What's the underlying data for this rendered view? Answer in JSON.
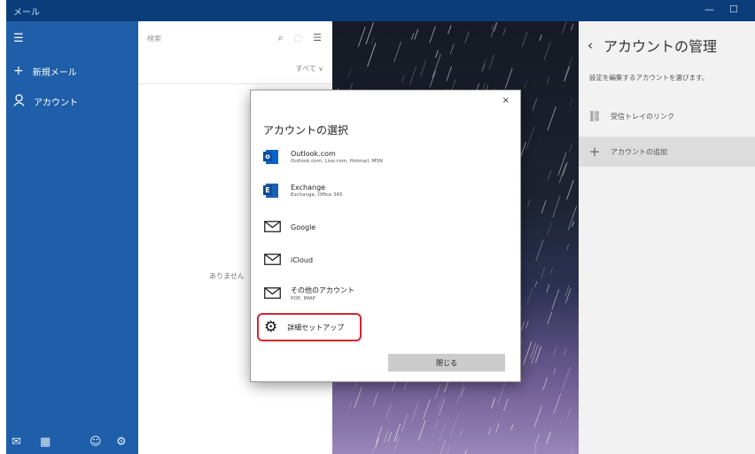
{
  "window": {
    "title": "メール",
    "controls": [
      "—",
      "☐"
    ]
  },
  "nav": {
    "items": [
      {
        "label": "新規メール",
        "icon": "plus-icon"
      },
      {
        "label": "アカウント",
        "icon": "person-icon"
      }
    ],
    "bottom_icons": [
      "mail-icon",
      "calendar-icon",
      "smiley-icon",
      "gear-icon"
    ]
  },
  "list": {
    "search_placeholder": "検索",
    "filter": "すべて ∨",
    "empty_text": "ありません"
  },
  "account_pane": {
    "title": "アカウントの管理",
    "description": "設定を編集するアカウントを選びます。",
    "items": [
      {
        "label": "受信トレイのリンク",
        "icon": "link-icon"
      },
      {
        "label": "アカウントの追加",
        "icon": "plus-icon"
      }
    ]
  },
  "dialog": {
    "title": "アカウントの選択",
    "close": "×",
    "accounts": [
      {
        "name": "Outlook.com",
        "sub": "Outlook.com, Live.com, Hotmail, MSN",
        "icon": "outlook-icon"
      },
      {
        "name": "Exchange",
        "sub": "Exchange, Office 365",
        "icon": "exchange-icon"
      },
      {
        "name": "Google",
        "sub": "",
        "icon": "mail-icon"
      },
      {
        "name": "iCloud",
        "sub": "",
        "icon": "mail-icon"
      },
      {
        "name": "その他のアカウント",
        "sub": "POP, IMAP",
        "icon": "mail-icon"
      }
    ],
    "advanced_setup": "詳細セットアップ",
    "close_button": "閉じる",
    "highlight_color": "#d22630"
  },
  "colors": {
    "nav": "#1f5ea8",
    "titlebar": "#0b3d7a"
  }
}
